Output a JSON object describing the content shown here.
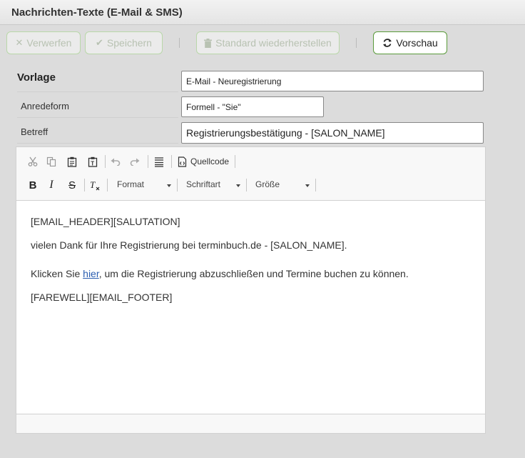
{
  "window": {
    "title": "Nachrichten-Texte (E-Mail & SMS)"
  },
  "toolbar": {
    "discard_label": "Verwerfen",
    "save_label": "Speichern",
    "restore_label": "Standard wiederherstellen",
    "preview_label": "Vorschau"
  },
  "form": {
    "template_label": "Vorlage",
    "template_value": "E-Mail - Neuregistrierung",
    "salutation_label": "Anredeform",
    "salutation_value": "Formell - \"Sie\"",
    "subject_label": "Betreff",
    "subject_value": "Registrierungsbestätigung - [SALON_NAME]"
  },
  "editor_toolbar": {
    "source_label": "Quellcode",
    "format_label": "Format",
    "font_label": "Schriftart",
    "size_label": "Größe"
  },
  "editor_content": {
    "line1": "[EMAIL_HEADER][SALUTATION]",
    "line2": "vielen Dank für Ihre Registrierung bei terminbuch.de - [SALON_NAME].",
    "line3_before": "Klicken Sie ",
    "line3_link": "hier",
    "line3_after": ", um die Registrierung abzuschließen und Termine buchen zu können.",
    "line4": "[FAREWELL][EMAIL_FOOTER]"
  },
  "colors": {
    "accent": "#5a9a3a",
    "link": "#2a5db0"
  }
}
